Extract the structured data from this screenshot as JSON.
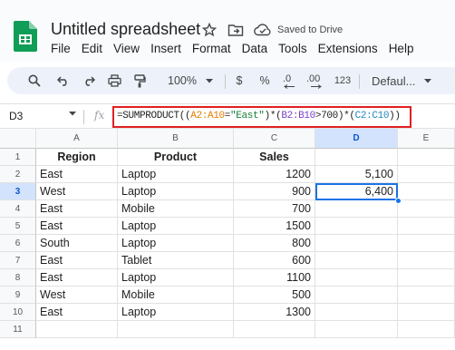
{
  "app": {
    "doc_title": "Untitled spreadsheet",
    "save_status": "Saved to Drive"
  },
  "menu": [
    "File",
    "Edit",
    "View",
    "Insert",
    "Format",
    "Data",
    "Tools",
    "Extensions",
    "Help"
  ],
  "toolbar": {
    "zoom": "100%",
    "currency": "$",
    "percent": "%",
    "dec_decrease": ".0",
    "dec_increase": ".00",
    "number_format": "123",
    "font": "Defaul..."
  },
  "formula_bar": {
    "cell_ref": "D3",
    "fx": "fx",
    "formula_parts": [
      "=SUMPRODUCT((",
      "A2:A10",
      "=",
      "\"East\"",
      ")*(",
      "B2:B10",
      ">700)*(",
      "C2:C10",
      "))"
    ]
  },
  "sheet": {
    "columns": [
      "A",
      "B",
      "C",
      "D",
      "E"
    ],
    "rows": [
      "1",
      "2",
      "3",
      "4",
      "5",
      "6",
      "7",
      "8",
      "9",
      "10",
      "11"
    ],
    "headers": [
      "Region",
      "Product",
      "Sales"
    ],
    "data": [
      [
        "East",
        "Laptop",
        "1200",
        "5,100"
      ],
      [
        "West",
        "Laptop",
        "900",
        "6,400"
      ],
      [
        "East",
        "Mobile",
        "700",
        ""
      ],
      [
        "East",
        "Laptop",
        "1500",
        ""
      ],
      [
        "South",
        "Laptop",
        "800",
        ""
      ],
      [
        "East",
        "Tablet",
        "600",
        ""
      ],
      [
        "East",
        "Laptop",
        "1100",
        ""
      ],
      [
        "West",
        "Mobile",
        "500",
        ""
      ],
      [
        "East",
        "Laptop",
        "1300",
        ""
      ]
    ],
    "selected_cell": "D3"
  },
  "colors": {
    "accent": "#1a73e8",
    "highlight_border": "#e02020",
    "sheets_green": "#0f9d58"
  }
}
